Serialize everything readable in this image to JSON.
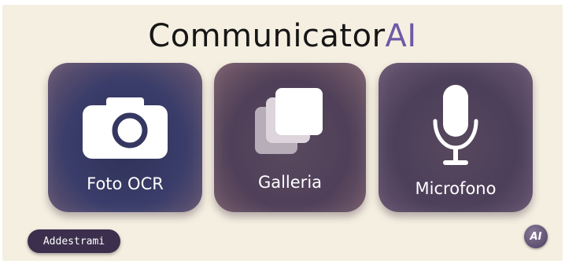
{
  "app": {
    "title_main": "Communicator",
    "title_accent": "AI"
  },
  "cards": [
    {
      "label": "Foto OCR",
      "icon": "camera-icon"
    },
    {
      "label": "Galleria",
      "icon": "gallery-icon"
    },
    {
      "label": "Microfono",
      "icon": "microphone-icon"
    }
  ],
  "footer": {
    "train_button": "Addestrami",
    "ai_badge": "AI"
  },
  "colors": {
    "background": "#f5efe1",
    "accent": "#6b5aa8",
    "button": "#3b2f4d"
  }
}
